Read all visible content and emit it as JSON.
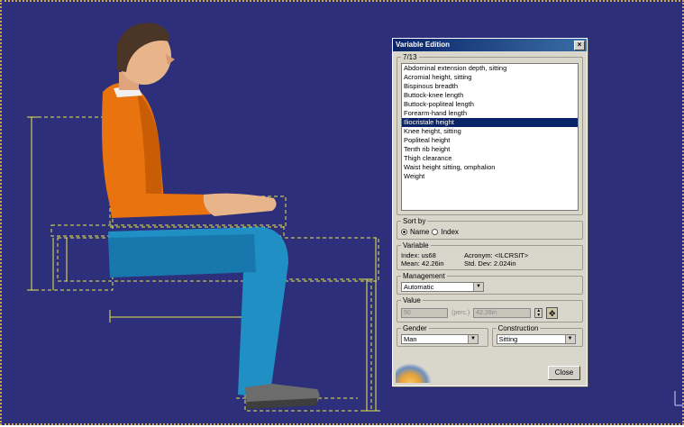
{
  "dialog": {
    "title": "Variable Edition",
    "close_glyph": "×",
    "list_group_label": "7/13",
    "variables": [
      "Abdominal extension depth, sitting",
      "Acromial height, sitting",
      "Bispinous breadth",
      "Buttock-knee length",
      "Buttock-popliteal length",
      "Forearm-hand length",
      "Iliocristale height",
      "Knee height, sitting",
      "Popliteal height",
      "Tenth rib height",
      "Thigh clearance",
      "Waist height sitting, omphalion",
      "Weight"
    ],
    "selected_index": 6,
    "sort_by": {
      "label": "Sort by",
      "name_option": "Name",
      "index_option": "Index",
      "selected": "Name"
    },
    "variable_info": {
      "label": "Variable",
      "index": "Index: us68",
      "acronym": "Acronym: <ILCRSIT>",
      "mean": "Mean: 42.26in",
      "std_dev": "Std. Dev: 2.024in"
    },
    "management": {
      "label": "Management",
      "value": "Automatic"
    },
    "value": {
      "label": "Value",
      "percent": "50",
      "percent_unit": "(perc.)",
      "length": "42.26in"
    },
    "gender": {
      "label": "Gender",
      "value": "Man"
    },
    "construction": {
      "label": "Construction",
      "value": "Sitting"
    },
    "close_label": "Close"
  },
  "colors": {
    "viewport_bg": "#2e2f7a",
    "guide_line": "#e8e84a",
    "shirt": "#e8730f",
    "pants": "#1f8fc4",
    "skin": "#e8b48a"
  },
  "icons": [
    "radio-icon",
    "dropdown-arrow-icon",
    "spinner-icon",
    "measure-tool-icon",
    "axis-compass-icon"
  ]
}
